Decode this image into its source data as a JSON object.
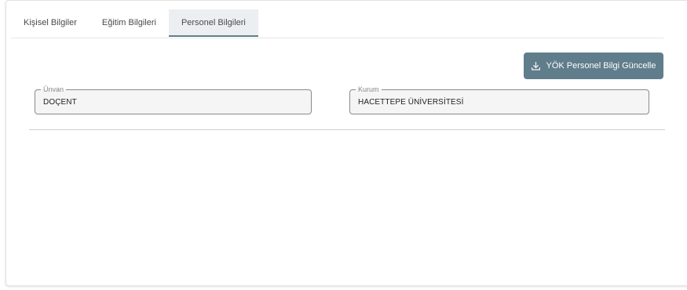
{
  "tabs": [
    {
      "label": "Kişisel Bilgiler",
      "active": false
    },
    {
      "label": "Eğitim Bilgileri",
      "active": false
    },
    {
      "label": "Personel Bilgileri",
      "active": true
    }
  ],
  "actions": {
    "update_button_label": "YÖK Personel Bilgi Güncelle",
    "update_button_icon": "download-icon"
  },
  "fields": {
    "unvan": {
      "label": "Ünvan",
      "value": "DOÇENT"
    },
    "kurum": {
      "label": "Kurum",
      "value": "HACETTEPE ÜNİVERSİTESİ"
    }
  },
  "colors": {
    "accent": "#607d8b",
    "active_tab_bg": "#eceff1",
    "field_bg": "#f5f5f5"
  }
}
